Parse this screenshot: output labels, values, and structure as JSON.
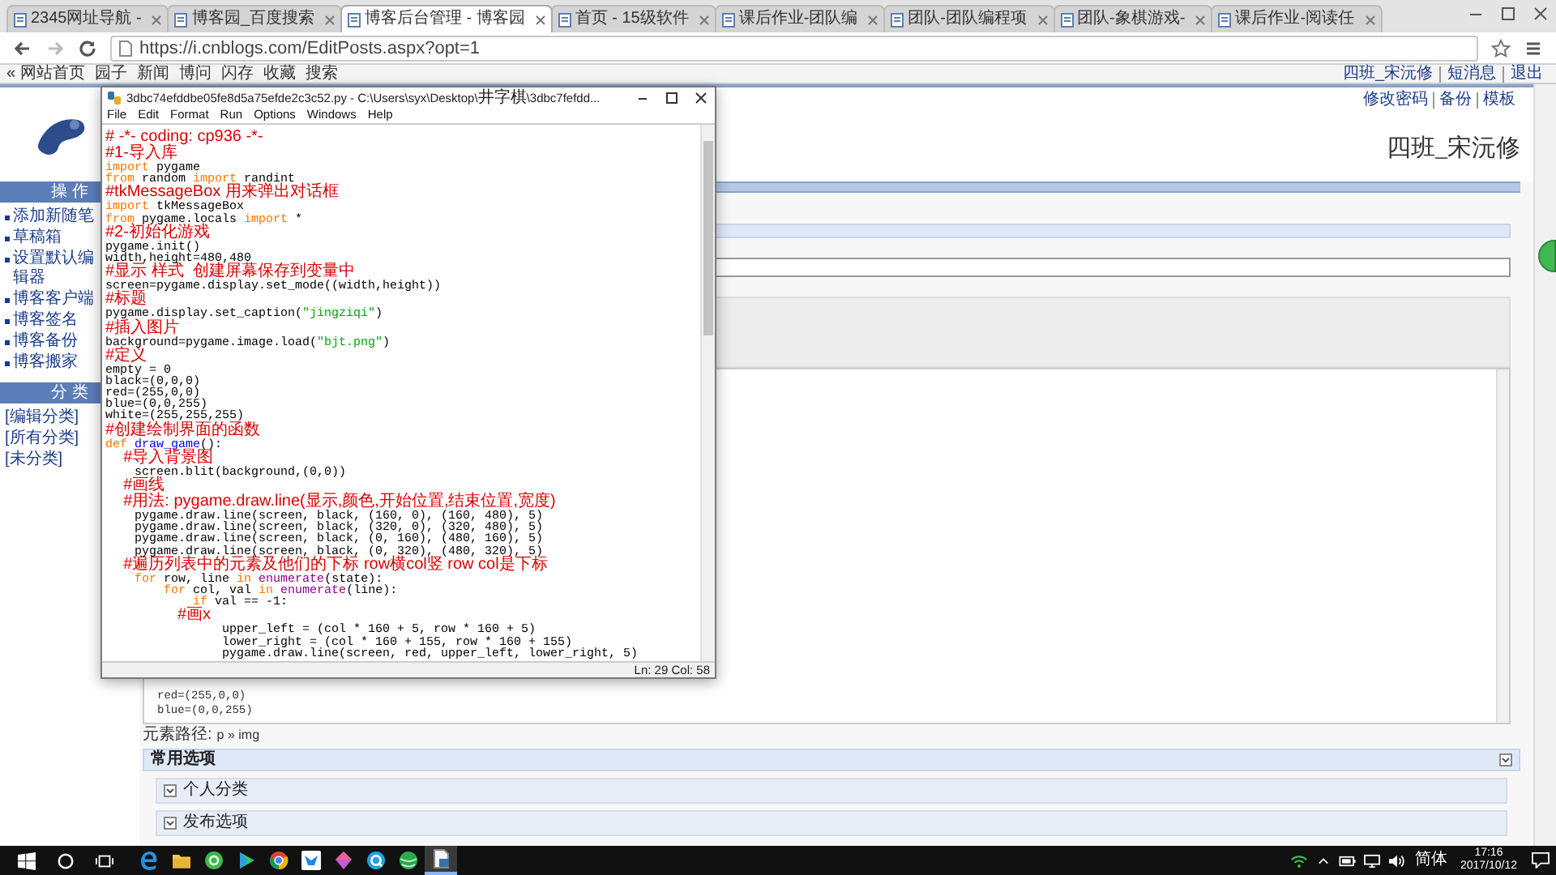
{
  "browser": {
    "tabs": [
      {
        "label": "2345网址导航 -",
        "selected": false
      },
      {
        "label": "博客园_百度搜索",
        "selected": false
      },
      {
        "label": "博客后台管理 - 博客园",
        "selected": true
      },
      {
        "label": "首页 - 15级软件",
        "selected": false
      },
      {
        "label": "课后作业-团队编",
        "selected": false
      },
      {
        "label": "团队-团队编程项",
        "selected": false
      },
      {
        "label": "团队-象棋游戏-",
        "selected": false
      },
      {
        "label": "课后作业-阅读任",
        "selected": false
      }
    ],
    "url": "https://i.cnblogs.com/EditPosts.aspx?opt=1"
  },
  "site_nav": {
    "links": [
      "« 网站首页",
      "园子",
      "新闻",
      "博问",
      "闪存",
      "收藏",
      "搜索"
    ],
    "user_links": [
      "四班_宋沅修",
      "短消息",
      "退出"
    ]
  },
  "blog_header": {
    "links": [
      "修改密码",
      "备份",
      "模板"
    ],
    "author": "四班_宋沅修"
  },
  "sidebar": {
    "sections": [
      {
        "title": "操 作",
        "items": [
          "添加新随笔",
          "草稿箱",
          "设置默认编辑器",
          "博客客户端",
          "博客签名",
          "博客备份",
          "博客搬家"
        ]
      },
      {
        "title": "分 类",
        "items": [
          "[编辑分类]",
          "[所有分类]",
          "[未分类]"
        ]
      }
    ]
  },
  "editor": {
    "visible_lines": [
      "red=(255,0,0)",
      "blue=(0,0,255)"
    ],
    "path_label": "元素路径:",
    "path": "p » img"
  },
  "panels": [
    {
      "title": "常用选项",
      "kind": "header"
    },
    {
      "title": "个人分类",
      "kind": "sub"
    },
    {
      "title": "发布选项",
      "kind": "sub"
    }
  ],
  "idle_window": {
    "title_parts": [
      {
        "text": "3dbc74efddbe05fe8d5a75efde2c3c52.py - C:\\Users\\syx\\Desktop\\",
        "kind": "latin"
      },
      {
        "text": "井字棋",
        "kind": "cjk"
      },
      {
        "text": "\\3dbc7fefdd...",
        "kind": "latin"
      }
    ],
    "menu": [
      "File",
      "Edit",
      "Format",
      "Run",
      "Options",
      "Windows",
      "Help"
    ],
    "lines": [
      [
        {
          "text": "# -*- coding: cp936 -*-",
          "kind": "comment"
        }
      ],
      [
        {
          "text": "#1-导入库",
          "kind": "comment"
        }
      ],
      [
        {
          "text": "import",
          "kind": "keyword"
        },
        {
          "text": " pygame",
          "kind": "plain"
        }
      ],
      [
        {
          "text": "from",
          "kind": "keyword"
        },
        {
          "text": " random ",
          "kind": "plain"
        },
        {
          "text": "import",
          "kind": "keyword"
        },
        {
          "text": " randint",
          "kind": "plain"
        }
      ],
      [
        {
          "text": "#tkMessageBox 用来弹出对话框",
          "kind": "comment"
        }
      ],
      [
        {
          "text": "import",
          "kind": "keyword"
        },
        {
          "text": " tkMessageBox",
          "kind": "plain"
        }
      ],
      [
        {
          "text": "from",
          "kind": "keyword"
        },
        {
          "text": " pygame.locals ",
          "kind": "plain"
        },
        {
          "text": "import",
          "kind": "keyword"
        },
        {
          "text": " *",
          "kind": "plain"
        }
      ],
      [
        {
          "text": "#2-初始化游戏",
          "kind": "comment"
        }
      ],
      [
        {
          "text": "pygame.init()",
          "kind": "plain"
        }
      ],
      [
        {
          "text": "width,height=480,480",
          "kind": "plain"
        }
      ],
      [
        {
          "text": "#显示 样式  创建屏幕保存到变量中",
          "kind": "comment"
        }
      ],
      [
        {
          "text": "screen=pygame.display.set_mode((width,height))",
          "kind": "plain"
        }
      ],
      [
        {
          "text": "#标题",
          "kind": "comment"
        }
      ],
      [
        {
          "text": "pygame.display.set_caption(",
          "kind": "plain"
        },
        {
          "text": "\"jingziqi\"",
          "kind": "string"
        },
        {
          "text": ")",
          "kind": "plain"
        }
      ],
      [
        {
          "text": "#插入图片",
          "kind": "comment"
        }
      ],
      [
        {
          "text": "background=pygame.image.load(",
          "kind": "plain"
        },
        {
          "text": "\"bjt.png\"",
          "kind": "string"
        },
        {
          "text": ")",
          "kind": "plain"
        }
      ],
      [
        {
          "text": "#定义",
          "kind": "comment"
        }
      ],
      [
        {
          "text": "empty = 0",
          "kind": "plain"
        }
      ],
      [
        {
          "text": "black=(0,0,0)",
          "kind": "plain"
        }
      ],
      [
        {
          "text": "red=(255,0,0)",
          "kind": "plain"
        }
      ],
      [
        {
          "text": "blue=(0,0,255)",
          "kind": "plain"
        }
      ],
      [
        {
          "text": "white=(255,255,255)",
          "kind": "plain"
        }
      ],
      [
        {
          "text": "#创建绘制界面的函数",
          "kind": "comment"
        }
      ],
      [
        {
          "text": "def",
          "kind": "keyword"
        },
        {
          "text": " draw_game",
          "kind": "name"
        },
        {
          "text": "():",
          "kind": "plain"
        }
      ],
      [
        {
          "text": "    #导入背景图",
          "kind": "comment"
        }
      ],
      [
        {
          "text": "    screen.blit(background,(0,0))",
          "kind": "plain"
        }
      ],
      [
        {
          "text": "    #画线",
          "kind": "comment"
        }
      ],
      [
        {
          "text": "    #用法: pygame.draw.line(显示,颜色,开始位置,结束位置,宽度)",
          "kind": "comment"
        }
      ],
      [
        {
          "text": "    pygame.draw.line(screen, black, (160, 0), (160, 480), 5)",
          "kind": "plain"
        }
      ],
      [
        {
          "text": "    pygame.draw.line(screen, black, (320, 0), (320, 480), 5)",
          "kind": "plain"
        }
      ],
      [
        {
          "text": "    pygame.draw.line(screen, black, (0, 160), (480, 160), 5)",
          "kind": "plain"
        }
      ],
      [
        {
          "text": "    pygame.draw.line(screen, black, (0, 320), (480, 320), 5)",
          "kind": "plain"
        }
      ],
      [
        {
          "text": "    #遍历列表中的元素及他们的下标 row横col竖 row col是下标",
          "kind": "comment"
        }
      ],
      [
        {
          "text": "    for",
          "kind": "keyword"
        },
        {
          "text": " row, line ",
          "kind": "plain"
        },
        {
          "text": "in",
          "kind": "keyword"
        },
        {
          "text": " enumerate",
          "kind": "builtin"
        },
        {
          "text": "(state):",
          "kind": "plain"
        }
      ],
      [
        {
          "text": "        for",
          "kind": "keyword"
        },
        {
          "text": " col, val ",
          "kind": "plain"
        },
        {
          "text": "in",
          "kind": "keyword"
        },
        {
          "text": " enumerate",
          "kind": "builtin"
        },
        {
          "text": "(line):",
          "kind": "plain"
        }
      ],
      [
        {
          "text": "            if",
          "kind": "keyword"
        },
        {
          "text": " val == -1:",
          "kind": "plain"
        }
      ],
      [
        {
          "text": "                #画x",
          "kind": "comment"
        }
      ],
      [
        {
          "text": "                upper_left = (col * 160 + 5, row * 160 + 5)",
          "kind": "plain"
        }
      ],
      [
        {
          "text": "                lower_right = (col * 160 + 155, row * 160 + 155)",
          "kind": "plain"
        }
      ],
      [
        {
          "text": "                pygame.draw.line(screen, red, upper_left, lower_right, 5)",
          "kind": "plain"
        }
      ]
    ],
    "status": "Ln: 29 Col: 58"
  },
  "taskbar": {
    "ime": "简体",
    "time": "17:16",
    "date": "2017/10/12"
  }
}
